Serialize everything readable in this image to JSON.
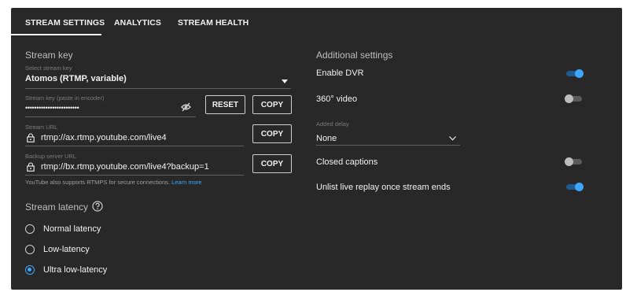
{
  "tabs": [
    {
      "label": "STREAM SETTINGS"
    },
    {
      "label": "ANALYTICS"
    },
    {
      "label": "STREAM HEALTH"
    }
  ],
  "stream_key": {
    "title": "Stream key",
    "select_label": "Select stream key",
    "select_value": "Atomos (RTMP, variable)",
    "key_label": "Stream key (paste in encoder)",
    "key_value": "••••••••••••••••••••••••",
    "reset_label": "RESET",
    "copy_label": "COPY"
  },
  "stream_url": {
    "label": "Stream URL",
    "value": "rtmp://ax.rtmp.youtube.com/live4",
    "copy_label": "COPY"
  },
  "backup_url": {
    "label": "Backup server URL",
    "value": "rtmp://bx.rtmp.youtube.com/live4?backup=1",
    "copy_label": "COPY"
  },
  "help": {
    "text": "YouTube also supports RTMPS for secure connections.",
    "link": "Learn more"
  },
  "latency": {
    "title": "Stream latency",
    "options": [
      {
        "label": "Normal latency",
        "selected": false
      },
      {
        "label": "Low-latency",
        "selected": false
      },
      {
        "label": "Ultra low-latency",
        "selected": true
      }
    ]
  },
  "additional": {
    "title": "Additional settings",
    "enable_dvr": {
      "label": "Enable DVR",
      "on": true
    },
    "video_360": {
      "label": "360° video",
      "on": false
    },
    "added_delay": {
      "label": "Added delay",
      "value": "None"
    },
    "closed_captions": {
      "label": "Closed captions",
      "on": false
    },
    "unlist_replay": {
      "label": "Unlist live replay once stream ends",
      "on": true
    }
  },
  "colors": {
    "panel_bg": "#282828",
    "accent": "#3ea6ff",
    "text": "#f1f1f1"
  },
  "icons": [
    "eye-off-icon",
    "lock-icon",
    "help-circle-icon",
    "dropdown-arrow-icon",
    "chevron-down-icon"
  ]
}
